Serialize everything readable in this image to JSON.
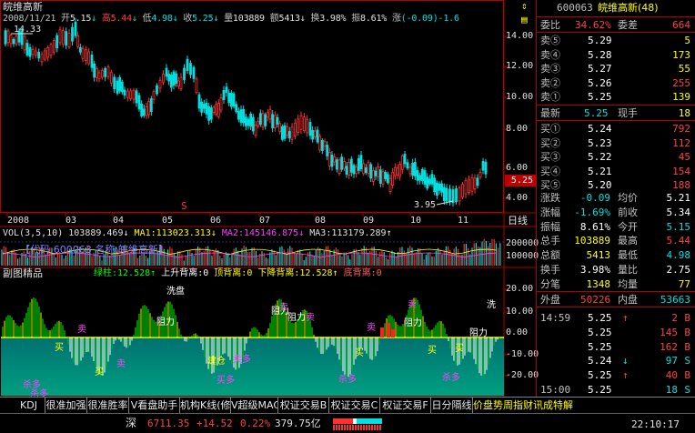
{
  "title": "皖维高新",
  "info_bar": {
    "date": "2008/11/21",
    "open_label": "开",
    "open": "5.15",
    "high_label": "高",
    "high": "5.44",
    "low_label": "低",
    "low": "4.98",
    "close_label": "收",
    "close": "5.25",
    "vol_label": "量",
    "vol": "103889",
    "amount_label": "额",
    "amount": "5413",
    "turnover_label": "换",
    "turnover": "3.98%",
    "amp_label": "振",
    "amp": "8.61%",
    "change_label": "涨",
    "change": "(-0.09)-1.6"
  },
  "price_axis": [
    "14.00",
    "12.00",
    "10.00",
    "8.00",
    "6.00",
    "4.00"
  ],
  "current_price_tag": "5.25",
  "max_price_label": "14.33",
  "min_price_label": "3.95",
  "s_marker": "S",
  "x_axis": [
    "2008",
    "03",
    "04",
    "05",
    "06",
    "07",
    "08",
    "09",
    "10",
    "11"
  ],
  "period_label": "日线",
  "vol_bar": {
    "label": "VOL(3,5,10)",
    "v": "103889.469",
    "ma1": "MA1:113023.313",
    "ma2": "MA2:145146.875",
    "ma3": "MA3:113179.289"
  },
  "vol_axis": [
    "200000",
    "100000"
  ],
  "vol_watermark": "【代码:600063 名称:皖维高新】",
  "indicator": {
    "name": "副图精品",
    "l1": "绿柱:12.528",
    "l2": "上升背离:0",
    "l3": "顶背离:0",
    "l4": "下降背离:12.528",
    "l5": "底背离:0",
    "axis": [
      "20.00",
      "10.00",
      "0.00",
      "-10.00",
      "-20.00"
    ],
    "tags": [
      "阻力",
      "阻力",
      "阻力",
      "阻力",
      "阻力",
      "卖",
      "卖",
      "卖",
      "卖",
      "卖",
      "买",
      "买",
      "买",
      "买",
      "买",
      "建仓",
      "洗盘",
      "卖",
      "洗",
      "卖多",
      "买多",
      "杀多",
      "杀多",
      "杀多",
      "杀多"
    ]
  },
  "side": {
    "code": "600063",
    "name": "皖维高新(48)",
    "weibi_label": "委比",
    "weibi": "34.62%",
    "weicha_label": "委差",
    "weicha": "664",
    "asks": [
      {
        "label": "卖⑤",
        "price": "5.29",
        "vol": "5"
      },
      {
        "label": "卖④",
        "price": "5.28",
        "vol": "173"
      },
      {
        "label": "卖③",
        "price": "5.27",
        "vol": "55"
      },
      {
        "label": "卖②",
        "price": "5.26",
        "vol": "255"
      },
      {
        "label": "卖①",
        "price": "5.25",
        "vol": "139"
      }
    ],
    "last_label": "最新",
    "last": "5.25",
    "xianshou_label": "现手",
    "xianshou": "18",
    "bids": [
      {
        "label": "买①",
        "price": "5.24",
        "vol": "792"
      },
      {
        "label": "买②",
        "price": "5.23",
        "vol": "112"
      },
      {
        "label": "买③",
        "price": "5.22",
        "vol": "45"
      },
      {
        "label": "买④",
        "price": "5.21",
        "vol": "154"
      },
      {
        "label": "买⑤",
        "price": "5.20",
        "vol": "188"
      }
    ],
    "stats": [
      {
        "l1": "涨跌",
        "v1": "-0.09",
        "l2": "均价",
        "v2": "5.21"
      },
      {
        "l1": "涨幅",
        "v1": "-1.69%",
        "l2": "前收",
        "v2": "5.34"
      },
      {
        "l1": "振幅",
        "v1": "8.61%",
        "l2": "今开",
        "v2": "5.15"
      },
      {
        "l1": "总手",
        "v1": "103889",
        "l2": "最高",
        "v2": "5.44"
      },
      {
        "l1": "总额",
        "v1": "5413",
        "l2": "最低",
        "v2": "4.98"
      },
      {
        "l1": "换手",
        "v1": "3.98%",
        "l2": "量比",
        "v2": "2.75"
      },
      {
        "l1": "分笔",
        "v1": "1348",
        "l2": "均量",
        "v2": "77"
      }
    ],
    "outer_label": "外盘",
    "outer": "50226",
    "inner_label": "内盘",
    "inner": "53663",
    "ticks": [
      {
        "t": "14:59",
        "p": "5.25",
        "a": "↑",
        "v": "2",
        "s": "B"
      },
      {
        "t": "",
        "p": "5.25",
        "a": "",
        "v": "145",
        "s": "B"
      },
      {
        "t": "",
        "p": "5.25",
        "a": "",
        "v": "162",
        "s": "B"
      },
      {
        "t": "",
        "p": "5.24",
        "a": "↓",
        "v": "97",
        "s": "S"
      },
      {
        "t": "",
        "p": "5.25",
        "a": "↑",
        "v": "40",
        "s": "B"
      },
      {
        "t": "15:00",
        "p": "5.25",
        "a": "",
        "v": "18",
        "s": "S"
      }
    ]
  },
  "tabs": [
    "KDJ",
    "很准加强",
    "很准胜率",
    "V看盘助手",
    "机构K线(修",
    "V超级MACD",
    "权证交易B",
    "权证交易C",
    "权证交易F",
    "日分隔线",
    "价盘势周指财讯成特解"
  ],
  "status": {
    "market": "深",
    "index": "6711.35",
    "change": "+14.52",
    "pct": "0.22%",
    "amount": "379.75亿",
    "time": "22:10:17"
  }
}
